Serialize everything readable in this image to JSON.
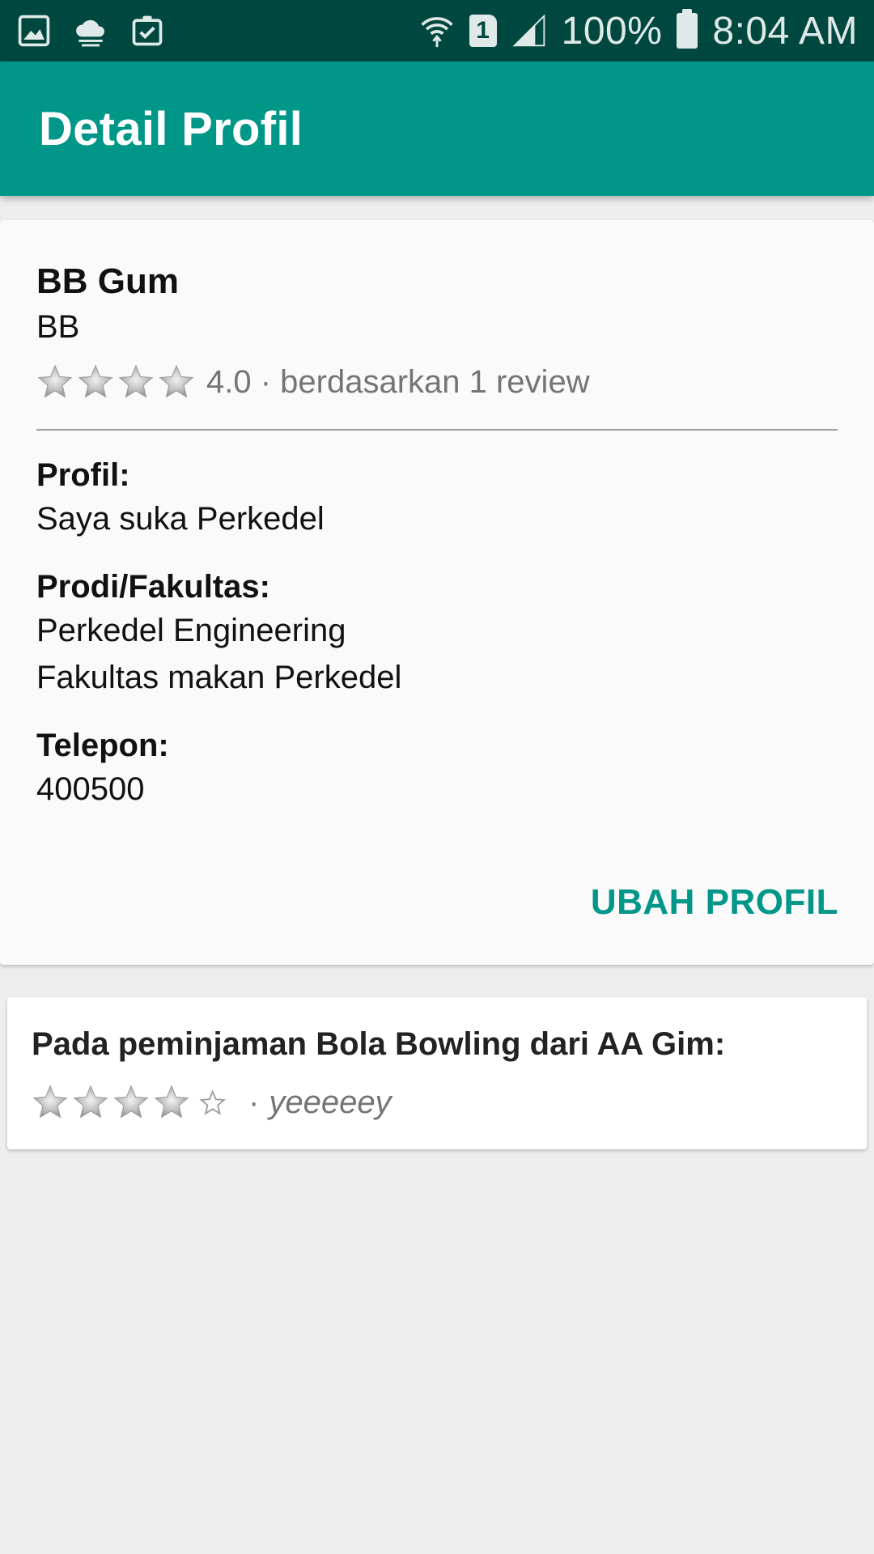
{
  "status_bar": {
    "left_icons": [
      "image-icon",
      "cloud-icon",
      "clipboard-check-icon"
    ],
    "right_icons": [
      "wifi-icon",
      "sim-icon",
      "signal-icon",
      "battery-icon"
    ],
    "sim_label": "1",
    "battery": "100%",
    "time": "8:04 AM"
  },
  "app_bar": {
    "title": "Detail Profil",
    "color": "#009688"
  },
  "profile": {
    "name": "BB Gum",
    "nickname": "BB",
    "rating_stars": 4,
    "rating_text": "4.0 · berdasarkan 1 review",
    "fields": [
      {
        "label": "Profil:",
        "value": "Saya suka Perkedel"
      },
      {
        "label": "Prodi/Fakultas:",
        "value": "Perkedel Engineering",
        "value2": "Fakultas makan Perkedel"
      },
      {
        "label": "Telepon:",
        "value": "400500"
      }
    ],
    "edit_button": "UBAH PROFIL"
  },
  "reviews": [
    {
      "title": "Pada peminjaman Bola Bowling dari AA Gim:",
      "stars_filled": 4,
      "stars_total": 5,
      "separator": "·",
      "text": "yeeeeey"
    }
  ]
}
